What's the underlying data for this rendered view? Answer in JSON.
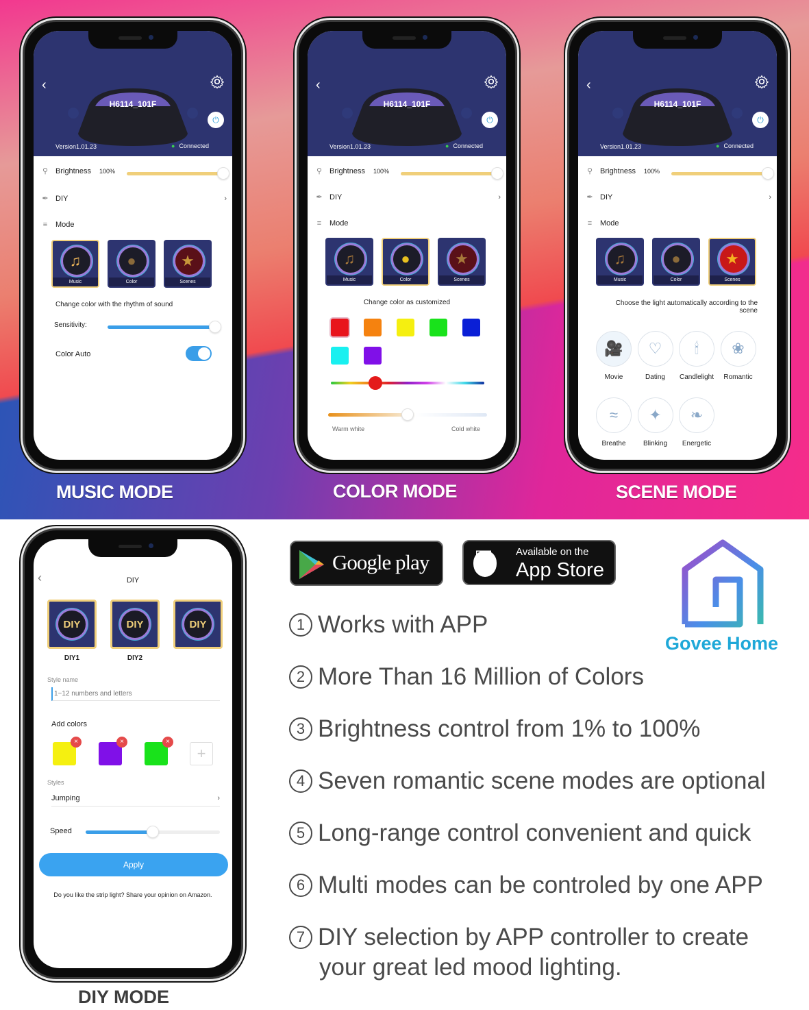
{
  "device": {
    "name": "H6114_101F",
    "version": "Version1.01.23",
    "status": "Connected"
  },
  "controls": {
    "brightness_label": "Brightness",
    "brightness_value": "100%",
    "brightness_fraction": 1.0,
    "diy_label": "DIY",
    "mode_label": "Mode"
  },
  "modes": [
    {
      "label": "Music",
      "icon": "music-note-icon"
    },
    {
      "label": "Color",
      "icon": "color-circles-icon"
    },
    {
      "label": "Scenes",
      "icon": "star-curtain-icon"
    }
  ],
  "music_screen": {
    "caption": "MUSIC MODE",
    "selected_mode": "Music",
    "description": "Change color with the rhythm of sound",
    "sensitivity_label": "Sensitivity:",
    "sensitivity_fraction": 1.0,
    "color_auto_label": "Color Auto",
    "color_auto_on": true
  },
  "color_screen": {
    "caption": "COLOR MODE",
    "selected_mode": "Color",
    "description": "Change color as customized",
    "swatches": [
      "#e8141c",
      "#f5820f",
      "#f5ef10",
      "#19e21b",
      "#0a1fd6",
      "#19f0f0",
      "#8010e8"
    ],
    "hue_fraction": 0.29,
    "warm_label": "Warm white",
    "cold_label": "Cold white",
    "white_fraction": 0.5
  },
  "scene_screen": {
    "caption": "SCENE MODE",
    "selected_mode": "Scenes",
    "description": "Choose the light automatically according to the scene",
    "scenes": [
      {
        "label": "Movie",
        "icon": "movie-camera-icon"
      },
      {
        "label": "Dating",
        "icon": "hearts-icon"
      },
      {
        "label": "Candlelight",
        "icon": "candle-icon"
      },
      {
        "label": "Romantic",
        "icon": "rose-icon"
      },
      {
        "label": "Breathe",
        "icon": "wind-icon"
      },
      {
        "label": "Blinking",
        "icon": "sparkle-icon"
      },
      {
        "label": "Energetic",
        "icon": "leaf-icon"
      }
    ]
  },
  "diy_screen": {
    "caption": "DIY MODE",
    "title": "DIY",
    "tiles": [
      {
        "text": "DIY",
        "label": "DIY1"
      },
      {
        "text": "DIY",
        "label": "DIY2"
      },
      {
        "text": "DIY",
        "label": ""
      }
    ],
    "style_name_label": "Style name",
    "style_name_placeholder": "1~12 numbers and letters",
    "add_colors_label": "Add colors",
    "added_colors": [
      "#f5f010",
      "#8010e8",
      "#19e21b"
    ],
    "styles_label": "Styles",
    "style_value": "Jumping",
    "speed_label": "Speed",
    "speed_fraction": 0.5,
    "apply_label": "Apply",
    "footer": "Do you like the strip light? Share your opinion on Amazon."
  },
  "stores": {
    "google": "Google play",
    "apple_small": "Available on the",
    "apple_big": "App Store"
  },
  "brand": {
    "name": "Govee Home",
    "color": "#1fa8d8"
  },
  "features": [
    {
      "num": "1",
      "text": "Works with APP"
    },
    {
      "num": "2",
      "text": "More Than 16 Million of Colors"
    },
    {
      "num": "3",
      "text": "Brightness control from 1% to 100%"
    },
    {
      "num": "4",
      "text": "Seven romantic scene modes are optional"
    },
    {
      "num": "5",
      "text": "Long-range control convenient and quick"
    },
    {
      "num": "6",
      "text": "Multi modes can be controled by one APP"
    },
    {
      "num": "7",
      "text": "DIY selection by APP controller to create",
      "text2": "your great led mood lighting."
    }
  ]
}
